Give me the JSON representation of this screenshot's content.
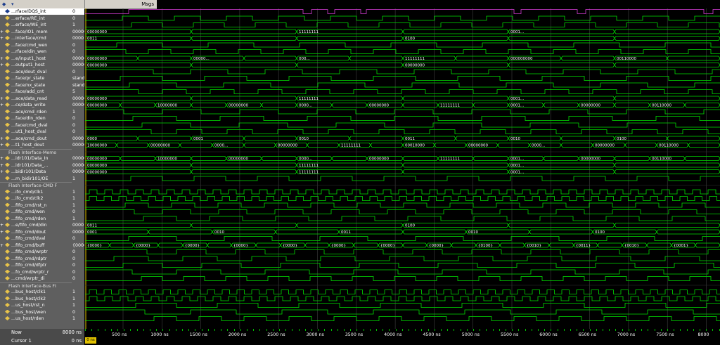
{
  "header": {
    "msgs_label": "Msgs"
  },
  "signals": [
    {
      "name": "...rface/DQS_int",
      "value": "0",
      "kind": "bit",
      "selected": true
    },
    {
      "name": "...erface/RE_int",
      "value": "0",
      "kind": "bit"
    },
    {
      "name": "...erface/WE_int",
      "value": "1",
      "kind": "bit"
    },
    {
      "name": "...face/IO1_mem",
      "value": "00000000",
      "kind": "bus",
      "expand": true
    },
    {
      "name": "...interface/cmd",
      "value": "0000",
      "kind": "bus",
      "expand": true
    },
    {
      "name": "...face/cmd_wen",
      "value": "0",
      "kind": "bit"
    },
    {
      "name": "...rface/din_wen",
      "value": "0",
      "kind": "bit"
    },
    {
      "name": "...e/input1_host",
      "value": "00000000",
      "kind": "bus",
      "expand": true
    },
    {
      "name": "...output1_host",
      "value": "00000000",
      "kind": "bus",
      "expand": true
    },
    {
      "name": "...ace/dout_dval",
      "value": "0",
      "kind": "bit"
    },
    {
      "name": "...face/pr_state",
      "value": "standby",
      "kind": "bit"
    },
    {
      "name": "...face/nx_state",
      "value": "standby",
      "kind": "bit"
    },
    {
      "name": "...face/add_cnt",
      "value": "5",
      "kind": "bit"
    },
    {
      "name": "...ace/data_read",
      "value": "00000000",
      "kind": "bus",
      "expand": true
    },
    {
      "name": "...ce/data_write",
      "value": "00000000",
      "kind": "bus",
      "expand": true
    },
    {
      "name": "...ace/cmd_rden",
      "value": "1",
      "kind": "bit"
    },
    {
      "name": "...face/din_rden",
      "value": "0",
      "kind": "bit"
    },
    {
      "name": "...face/cmd_dval",
      "value": "0",
      "kind": "bit"
    },
    {
      "name": "...ut1_host_dval",
      "value": "0",
      "kind": "bit"
    },
    {
      "name": "...ace/cmd_dout",
      "value": "0000",
      "kind": "bus",
      "expand": true
    },
    {
      "name": "...t1_host_dout",
      "value": "00000000",
      "kind": "bus",
      "expand": true
    },
    {
      "name": "Flash Interface-Memo",
      "value": "",
      "kind": "group"
    },
    {
      "name": "...idr101/Data_In",
      "value": "00000000",
      "kind": "bus",
      "expand": true
    },
    {
      "name": "...idr101/Data_...",
      "value": "00000000",
      "kind": "bus",
      "expand": true
    },
    {
      "name": "...bidir101/Data",
      "value": "00000000",
      "kind": "bus",
      "expand": true
    },
    {
      "name": "...m_bidir101/OE",
      "value": "1",
      "kind": "bit"
    },
    {
      "name": "Flash Interface-CMD F",
      "value": "",
      "kind": "group"
    },
    {
      "name": "...ifo_cmd/clk1",
      "value": "1",
      "kind": "bit"
    },
    {
      "name": "...ifo_cmd/clk2",
      "value": "1",
      "kind": "bit"
    },
    {
      "name": "...fifo_cmd/rst_n",
      "value": "1",
      "kind": "bit"
    },
    {
      "name": "...fifo_cmd/wen",
      "value": "0",
      "kind": "bit"
    },
    {
      "name": "...fifo_cmd/rden",
      "value": "1",
      "kind": "bit"
    },
    {
      "name": "...e/fifo_cmd/din",
      "value": "0000",
      "kind": "bus",
      "expand": true
    },
    {
      "name": "...fifo_cmd/dout",
      "value": "0000",
      "kind": "bus",
      "expand": true
    },
    {
      "name": "...fifo_cmd/dval",
      "value": "0",
      "kind": "bit"
    },
    {
      "name": "...fifo_cmd/buff",
      "value": "{0000} {00...",
      "kind": "bus",
      "expand": true
    },
    {
      "name": "...fifo_cmd/wrptr",
      "value": "0",
      "kind": "bit"
    },
    {
      "name": "...fifo_cmd/rdptr",
      "value": "0",
      "kind": "bit"
    },
    {
      "name": "...fifo_cmd/dfptr",
      "value": "0",
      "kind": "bit"
    },
    {
      "name": "...fo_cmd/wrptr_r",
      "value": "0",
      "kind": "bit"
    },
    {
      "name": "...cmd/wrptr_di",
      "value": "0",
      "kind": "bit"
    },
    {
      "name": "Flash Interface-Bus FI",
      "value": "",
      "kind": "group"
    },
    {
      "name": "...bus_host/clk1",
      "value": "1",
      "kind": "bit"
    },
    {
      "name": "...bus_host/clk2",
      "value": "1",
      "kind": "bit"
    },
    {
      "name": "...us_host/rst_n",
      "value": "1",
      "kind": "bit"
    },
    {
      "name": "...bus_host/wen",
      "value": "0",
      "kind": "bit"
    },
    {
      "name": "...us_host/rden",
      "value": "1",
      "kind": "bit"
    }
  ],
  "bus_labels": {
    "r3": [
      "00000000",
      "11111111",
      "0001..."
    ],
    "r4": [
      "0011",
      "0100"
    ],
    "r7": [
      "00000000",
      "00000...",
      "000...",
      "11111111",
      "000000000",
      "00110000"
    ],
    "r8": [
      "00000000",
      "00000000"
    ],
    "r10": [
      "standby",
      "idle",
      "com...",
      "com...",
      "address1",
      "program1",
      "idle",
      "com...",
      "com...",
      "address1",
      "read2",
      "idle"
    ],
    "r11": [
      "standby",
      "idle",
      "com...",
      "com...",
      "address1",
      "program1",
      "idle",
      "com...",
      "com...",
      "address1",
      "read2",
      "idle"
    ],
    "r12": [
      "4",
      "3",
      "2",
      "1",
      "0",
      "5",
      "4",
      "3",
      "2",
      "1",
      "0",
      "5"
    ],
    "r13": [
      "00000000",
      "11111111",
      "0001..."
    ],
    "r14": [
      "00000000",
      "10000000",
      "00000000",
      "0000...",
      "00000000",
      "11111111",
      "0001...",
      "00000000",
      "00110000"
    ],
    "r19": [
      "0000",
      "0001",
      "0010",
      "0011",
      "0010",
      "0100"
    ],
    "r20": [
      "10000000",
      "00000000",
      "0000...",
      "00000000",
      "11111111",
      "00010000",
      "00000000",
      "0000...",
      "00000000",
      "00110000"
    ],
    "r22": [
      "00000000",
      "10000000",
      "00000000",
      "0000...",
      "00000000",
      "11111111",
      "0001...",
      "00000000",
      "00110000"
    ],
    "r23": [
      "00000000",
      "11111111",
      "0001..."
    ],
    "r24": [
      "00000000",
      "11111111",
      "0001..."
    ],
    "r32": [
      "0011",
      "0100"
    ],
    "r33": [
      "0001",
      "0010",
      "0011",
      "0010",
      "0100"
    ],
    "r35": [
      "{0000}",
      "{0000}",
      "{0000}",
      "{0000}",
      "{0000}",
      "{0000}",
      "{0000}",
      "{0000}",
      "{0100}",
      "{0010}",
      "{0011}",
      "{0010}",
      "{0001}"
    ],
    "r36": [
      "0",
      "1",
      "2",
      "3",
      "4",
      "5"
    ],
    "r37": [
      "0",
      "1",
      "2",
      "3",
      "4",
      "5"
    ],
    "r38": [
      "0",
      "1",
      "2",
      "1",
      "0",
      "1",
      "2",
      "1",
      "0"
    ],
    "r39": [
      "0",
      "1",
      "2",
      "3",
      "4",
      "5"
    ],
    "r40": [
      "0",
      "1",
      "2",
      "3",
      "4",
      "5"
    ]
  },
  "timeline": {
    "now_label": "Now",
    "now_value": "8000 ns",
    "cursor_label": "Cursor 1",
    "cursor_value": "0 ns",
    "cursor_flag": "0 ns",
    "ticks": [
      "500 ns",
      "1000 ns",
      "1500 ns",
      "2000 ns",
      "2500 ns",
      "3000 ns",
      "3500 ns",
      "4000 ns",
      "4500 ns",
      "5000 ns",
      "5500 ns",
      "6000 ns",
      "6500 ns",
      "7000 ns",
      "7500 ns",
      "8000"
    ]
  },
  "colors": {
    "wave": "#00e000",
    "bus_text": "#ffffff",
    "selected_wave": "#d23cd2",
    "grid": "#404040",
    "cursor": "#e0c000"
  }
}
